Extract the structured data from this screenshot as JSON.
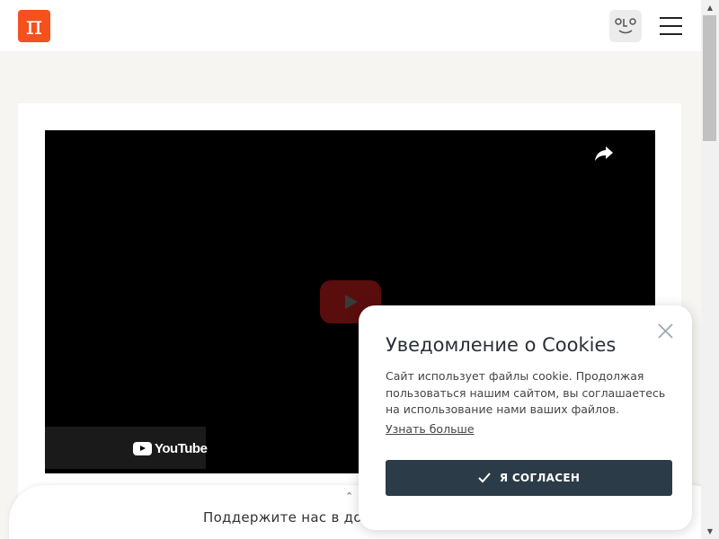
{
  "header": {
    "logo_text": "π",
    "logo_color": "#f4511e",
    "avatar_icon": "face-icon",
    "menu_icon": "hamburger-icon"
  },
  "video": {
    "share_icon": "share-icon",
    "play_icon": "youtube-play-icon",
    "youtube_label": "YouTube"
  },
  "donate": {
    "text": "Поддержите нас в до"
  },
  "cookie": {
    "title": "Уведомление о Cookies",
    "text": "Сайт использует файлы cookie. Продолжая пользоваться нашим сайтом, вы соглашаетесь на использование нами ваших файлов.",
    "link": "Узнать больше",
    "accept_label": "Я СОГЛАСЕН",
    "accept_color": "#2c3b48"
  }
}
